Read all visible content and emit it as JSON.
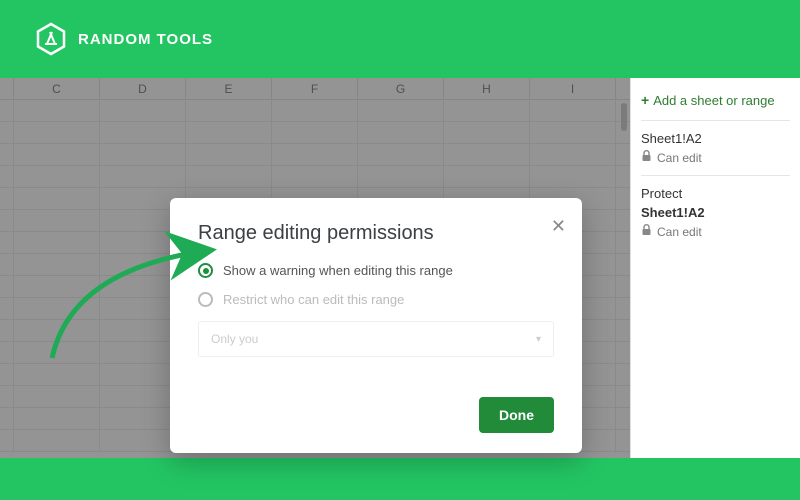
{
  "brand": {
    "name": "RANDOM TOOLS"
  },
  "columns": [
    "C",
    "D",
    "E",
    "F",
    "G",
    "H",
    "I"
  ],
  "side_panel": {
    "add_label": "Add a sheet or range",
    "items": [
      {
        "title": "Sheet1!A2",
        "sub": "Can edit"
      },
      {
        "title": "Protect",
        "range": "Sheet1!A2",
        "sub": "Can edit"
      }
    ]
  },
  "dialog": {
    "title": "Range editing permissions",
    "option_warning": "Show a warning when editing this range",
    "option_restrict": "Restrict who can edit this range",
    "select_placeholder": "Only you",
    "done": "Done"
  }
}
